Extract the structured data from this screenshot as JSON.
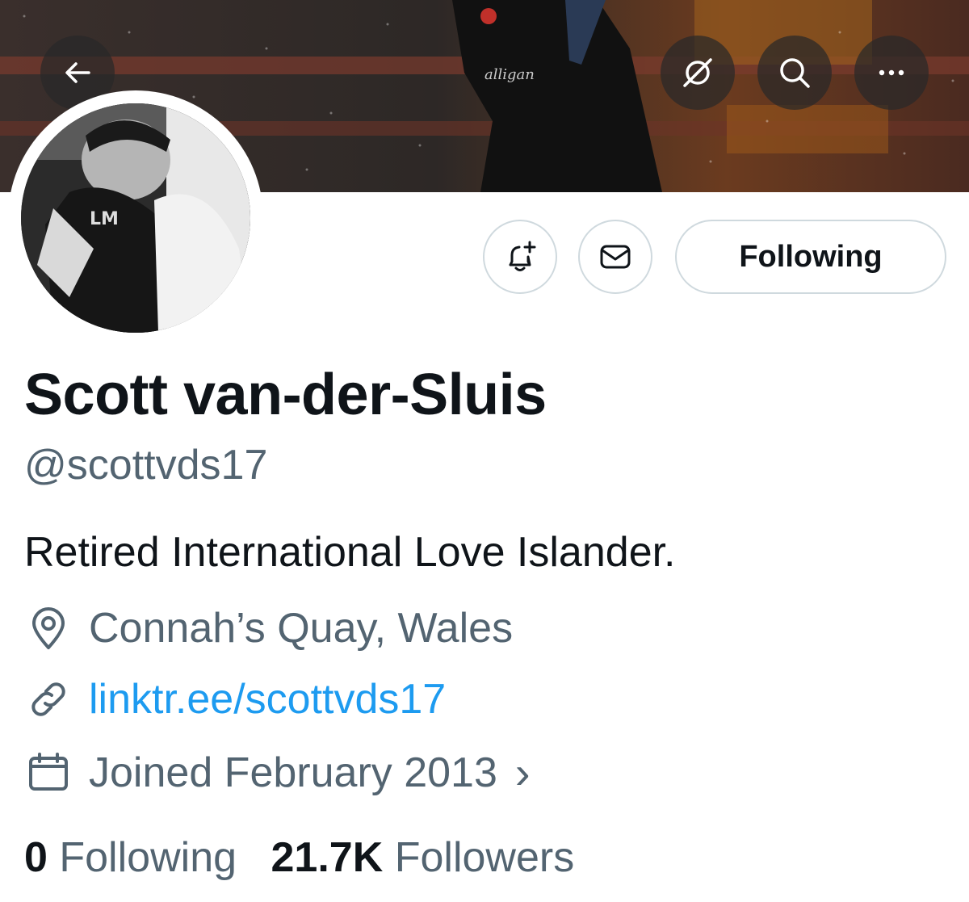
{
  "header": {
    "icons": {
      "back": "arrow-left-icon",
      "translate": "circle-slash-icon",
      "search": "search-icon",
      "more": "more-horizontal-icon"
    }
  },
  "actions": {
    "notify_icon": "bell-plus-icon",
    "message_icon": "envelope-icon",
    "follow_label": "Following"
  },
  "profile": {
    "name": "Scott van-der-Sluis",
    "handle": "@scottvds17",
    "bio": "Retired International Love Islander.",
    "location": "Connah’s Quay, Wales",
    "website": "linktr.ee/scottvds17",
    "joined": "Joined February 2013",
    "joined_chevron": "›"
  },
  "stats": {
    "following_count": "0",
    "following_label": "Following",
    "followers_count": "21.7K",
    "followers_label": "Followers"
  },
  "colors": {
    "link": "#1d9bf0",
    "secondary_text": "#536471",
    "primary_text": "#0f1419",
    "border": "#cfd9de"
  }
}
